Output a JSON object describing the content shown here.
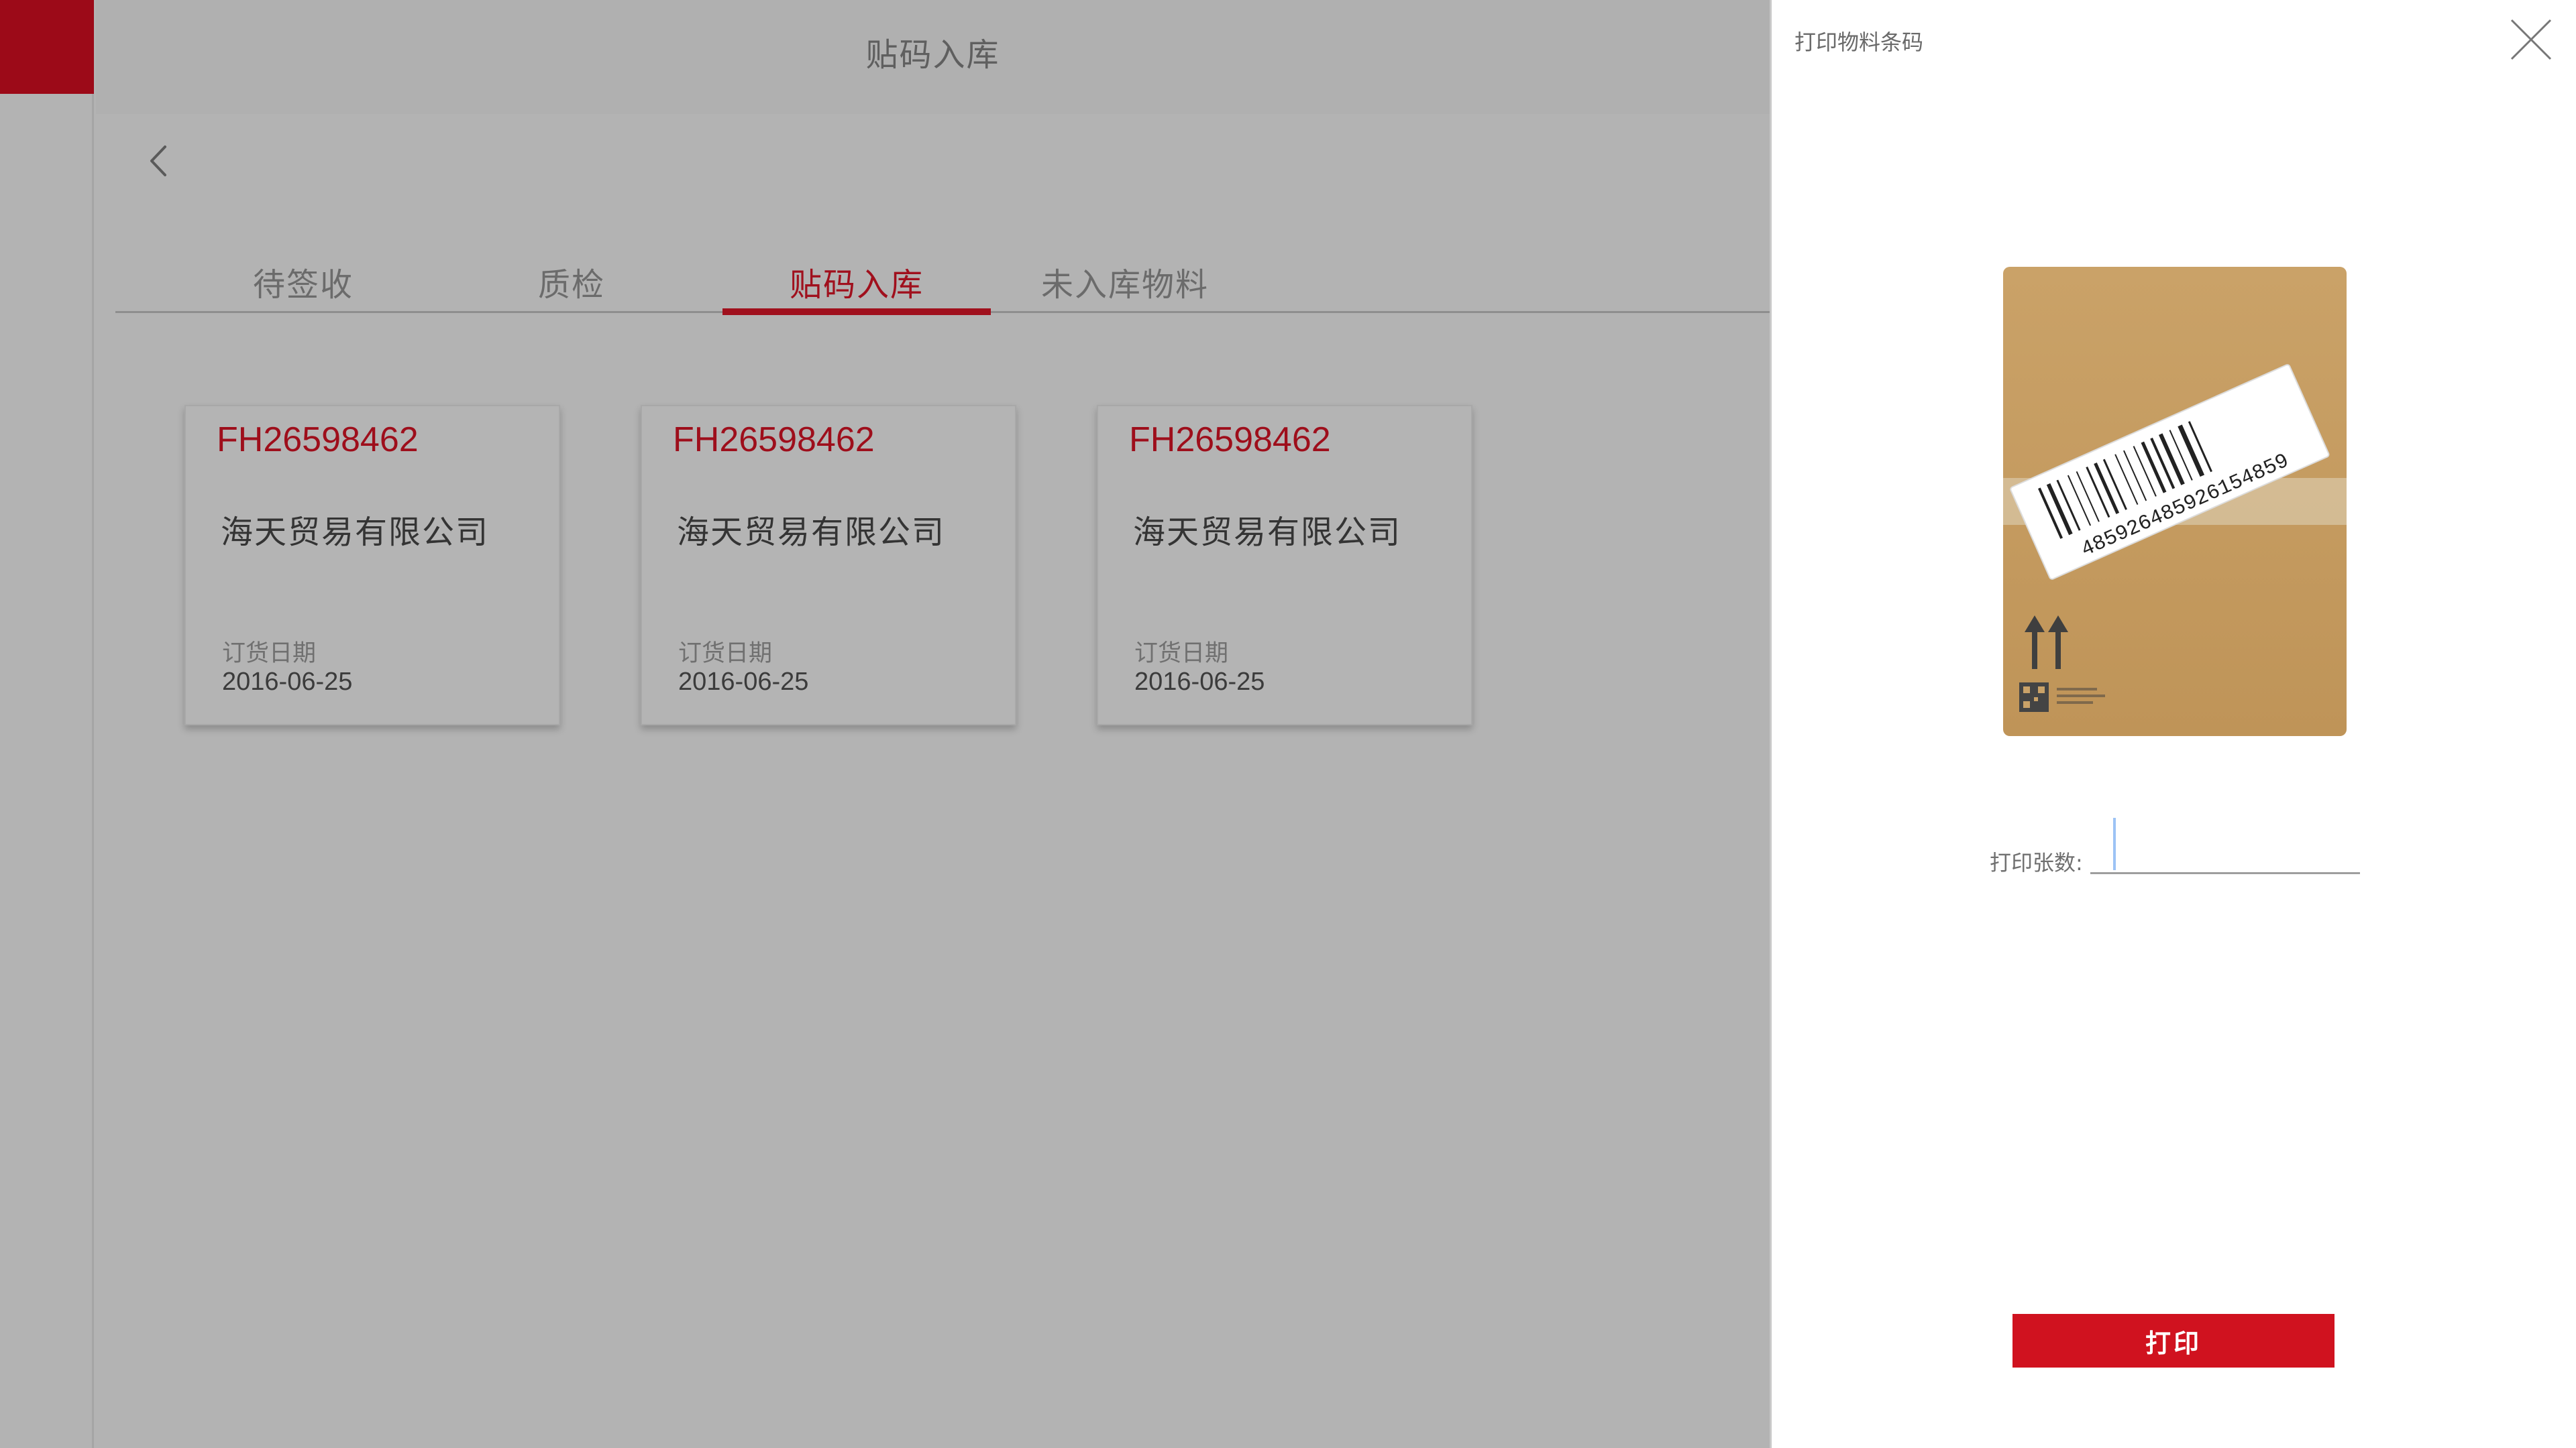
{
  "header": {
    "title": "贴码入库"
  },
  "tabs": [
    {
      "label": "待签收",
      "active": false
    },
    {
      "label": "质检",
      "active": false
    },
    {
      "label": "贴码入库",
      "active": true
    },
    {
      "label": "未入库物料",
      "active": false
    }
  ],
  "cards": [
    {
      "code": "FH26598462",
      "company": "海天贸易有限公司",
      "date_label": "订货日期",
      "date": "2016-06-25"
    },
    {
      "code": "FH26598462",
      "company": "海天贸易有限公司",
      "date_label": "订货日期",
      "date": "2016-06-25"
    },
    {
      "code": "FH26598462",
      "company": "海天贸易有限公司",
      "date_label": "订货日期",
      "date": "2016-06-25"
    }
  ],
  "drawer": {
    "title": "打印物料条码",
    "barcode_number": "485926485926154859",
    "quantity_label": "打印张数:",
    "quantity_value": "",
    "print_label": "打印"
  },
  "colors": {
    "brand_red": "#9c0a18",
    "button_red": "#d0121f",
    "overlay_gray": "#b3b3b3"
  },
  "icons": {
    "back": "chevron-left-icon",
    "close": "close-icon",
    "arrows": "this-side-up-icon",
    "qr": "qr-code-icon"
  }
}
